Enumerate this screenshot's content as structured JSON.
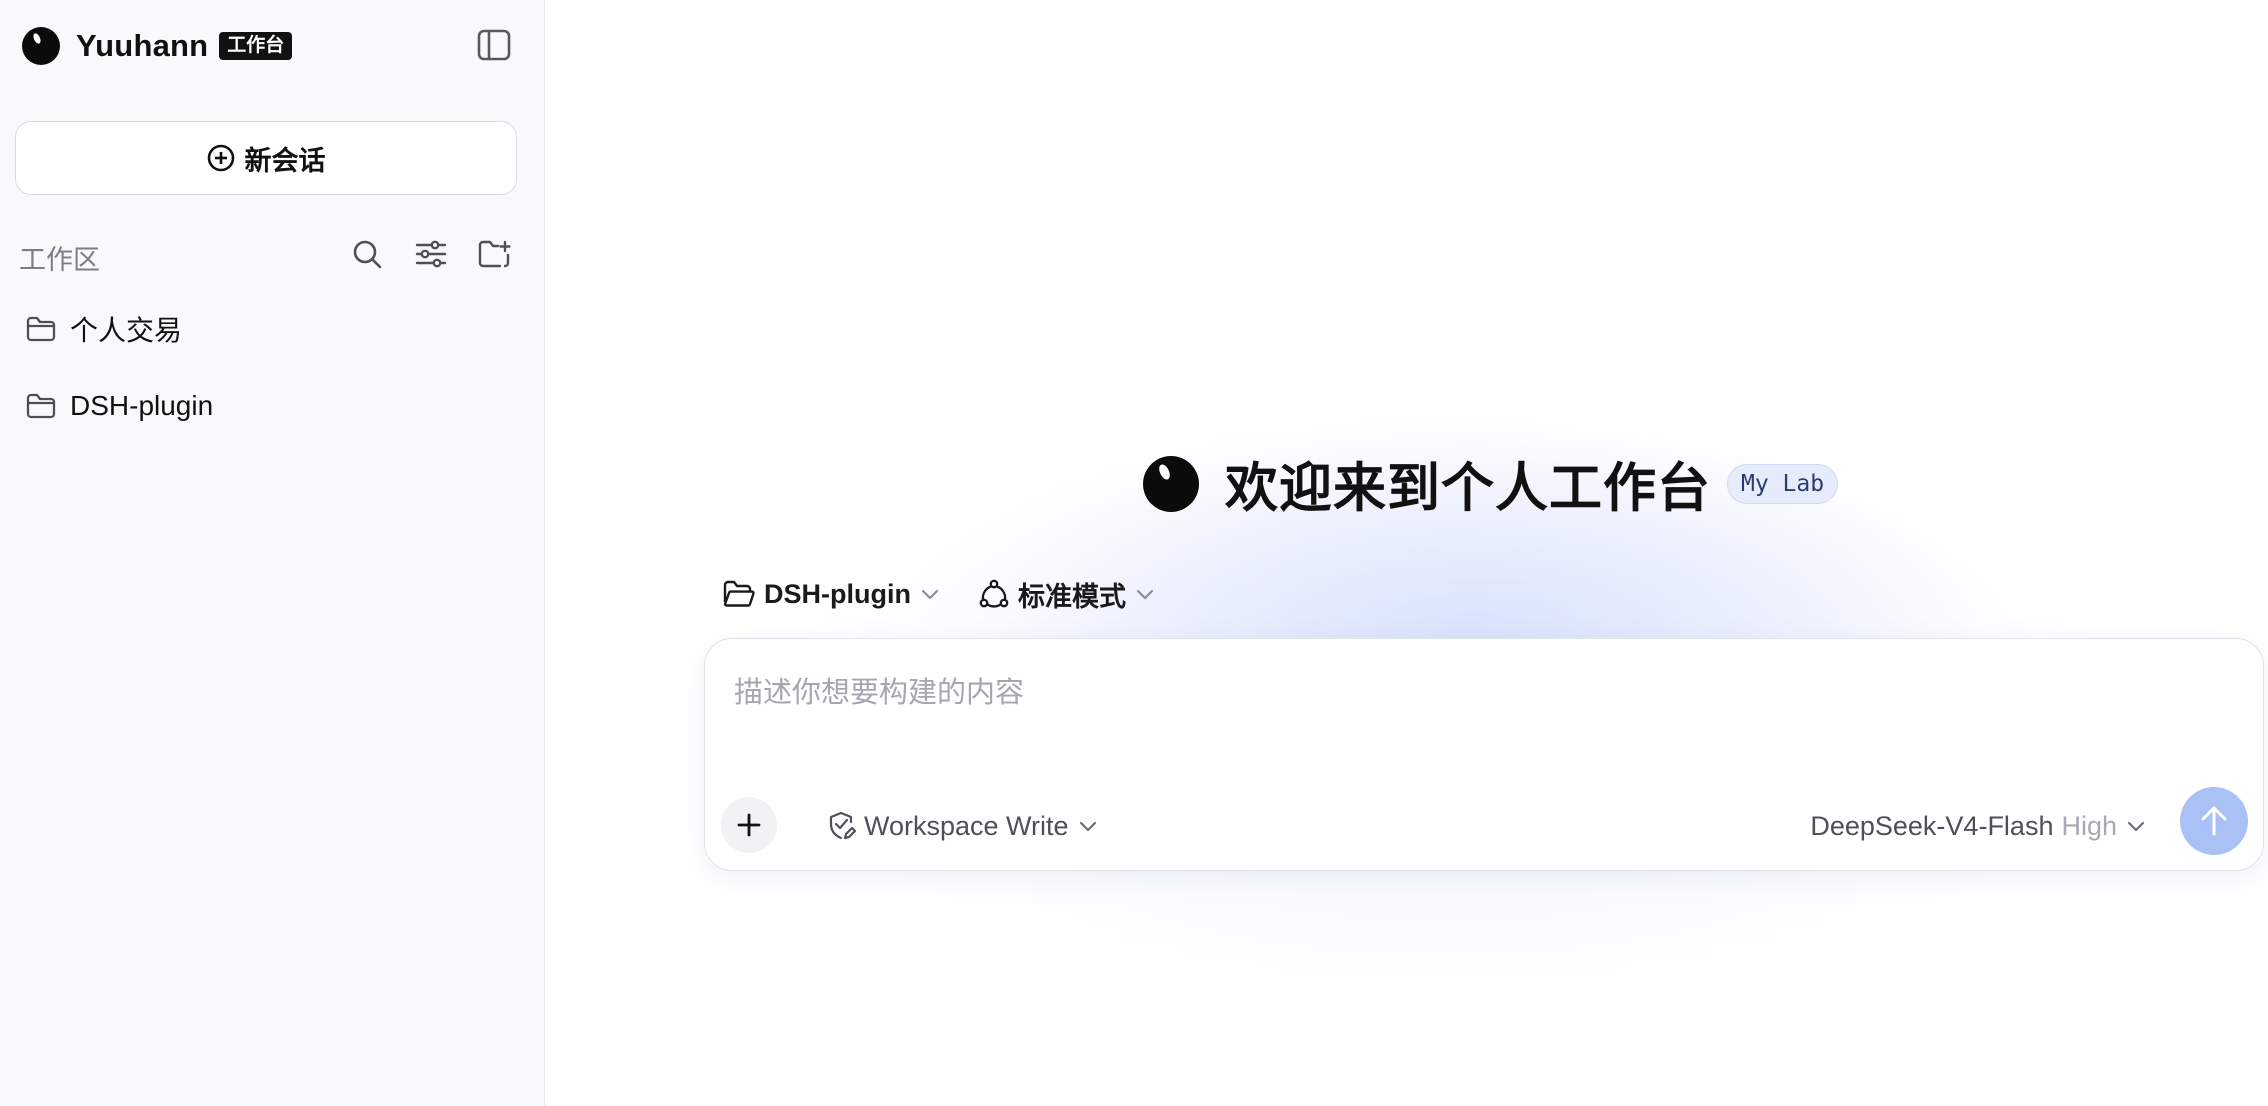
{
  "sidebar": {
    "brand": {
      "name": "Yuuhann",
      "badge": "工作台",
      "logo_icon": "black-ball-logo"
    },
    "collapse_icon": "sidebar-toggle-icon",
    "new_chat": {
      "label": "新会话",
      "icon": "plus-circle-icon"
    },
    "workspace": {
      "title": "工作区",
      "tools": [
        "search-icon",
        "sliders-icon",
        "folder-plus-icon"
      ],
      "folders": [
        {
          "label": "个人交易",
          "icon": "folder-icon"
        },
        {
          "label": "DSH-plugin",
          "icon": "folder-icon"
        }
      ]
    }
  },
  "main": {
    "welcome": {
      "title": "欢迎来到个人工作台",
      "tag": "My Lab"
    },
    "project_selector": {
      "label": "DSH-plugin",
      "icon": "folder-open-icon"
    },
    "mode_selector": {
      "label": "标准模式",
      "icon": "nodes-icon"
    },
    "composer": {
      "placeholder": "描述你想要构建的内容",
      "value": "",
      "permission": {
        "label": "Workspace Write",
        "icon": "shield-edit-icon"
      },
      "model": {
        "name": "DeepSeek-V4-Flash",
        "effort": "High"
      },
      "send_icon": "arrow-up-icon",
      "attach_icon": "plus-icon"
    }
  },
  "colors": {
    "sidebar_bg": "#f8f9fb",
    "send_button": "#a9c1f5",
    "tag_bg": "#e6ecfb",
    "tag_text": "#2d3b73"
  }
}
